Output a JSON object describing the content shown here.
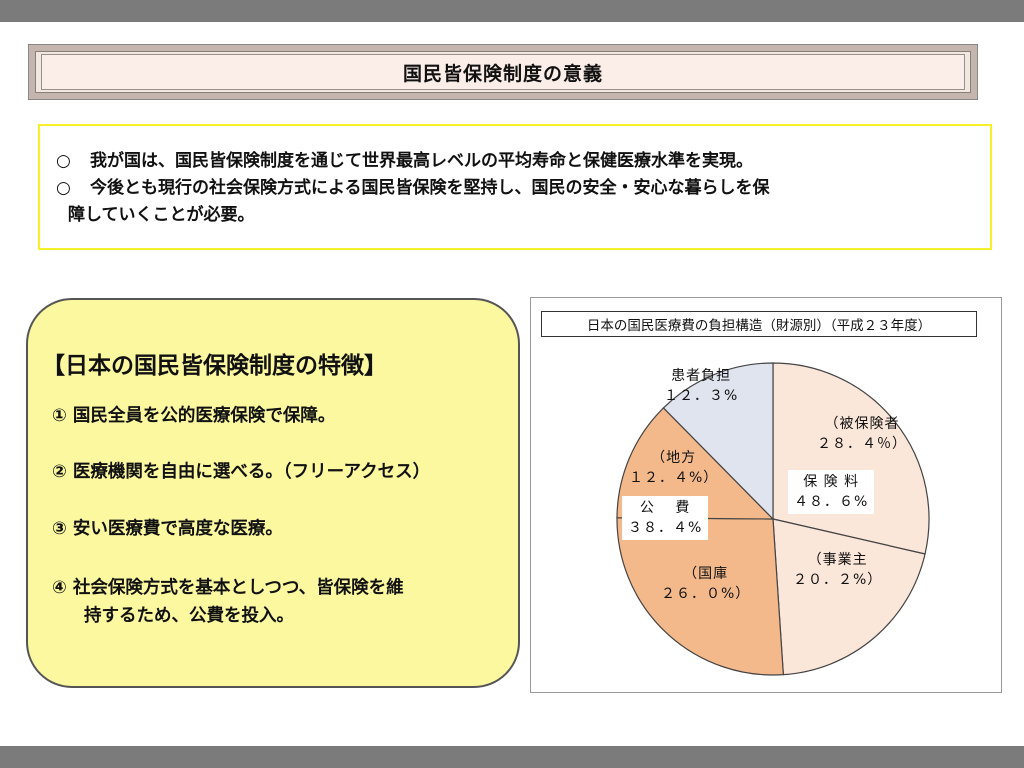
{
  "page_title": "国民皆保険制度の意義",
  "notice": {
    "bullet": "○",
    "line1": "我が国は、国民皆保険制度を通じて世界最高レベルの平均寿命と保健医療水準を実現。",
    "line2a": "今後とも現行の社会保険方式による国民皆保険を堅持し、国民の安全・安心な暮らしを保",
    "line2b": "障していくことが必要。"
  },
  "features": {
    "heading": "【日本の国民皆保険制度の特徴】",
    "items": [
      "①  国民全員を公的医療保険で保障。",
      "②  医療機関を自由に選べる。（フリーアクセス）",
      "③ 安い医療費で高度な医療。",
      "④ 社会保険方式を基本としつつ、皆保険を維",
      "持するため、公費を投入。"
    ]
  },
  "chart_data": {
    "type": "pie",
    "title": "日本の国民医療費の負担構造（財源別）（平成２３年度）",
    "unit": "%",
    "slices": [
      {
        "name": "被保険者",
        "label": "（被保険者",
        "value_text": "２８．４％）",
        "value": 28.4,
        "color": "#fbe6da"
      },
      {
        "name": "事業主",
        "label": "（事業主",
        "value_text": "２０．２%）",
        "value": 20.2,
        "color": "#fbe6da"
      },
      {
        "name": "国庫",
        "label": "（国庫",
        "value_text": "２６．０%）",
        "value": 26.0,
        "color": "#f4b98b"
      },
      {
        "name": "地方",
        "label": "（地方",
        "value_text": "１２．４%）",
        "value": 12.4,
        "color": "#f4b98b"
      },
      {
        "name": "患者負担",
        "label": "患者負担",
        "value_text": "１２．３%",
        "value": 12.3,
        "color": "#dfe4ef"
      }
    ],
    "groups": [
      {
        "name": "保険料",
        "label": "保 険 料",
        "value_text": "４８．６%",
        "value": 48.6
      },
      {
        "name": "公費",
        "label": "公　 費",
        "value_text": "３８．４%",
        "value": 38.4
      }
    ],
    "stroke_color": "#444444"
  }
}
